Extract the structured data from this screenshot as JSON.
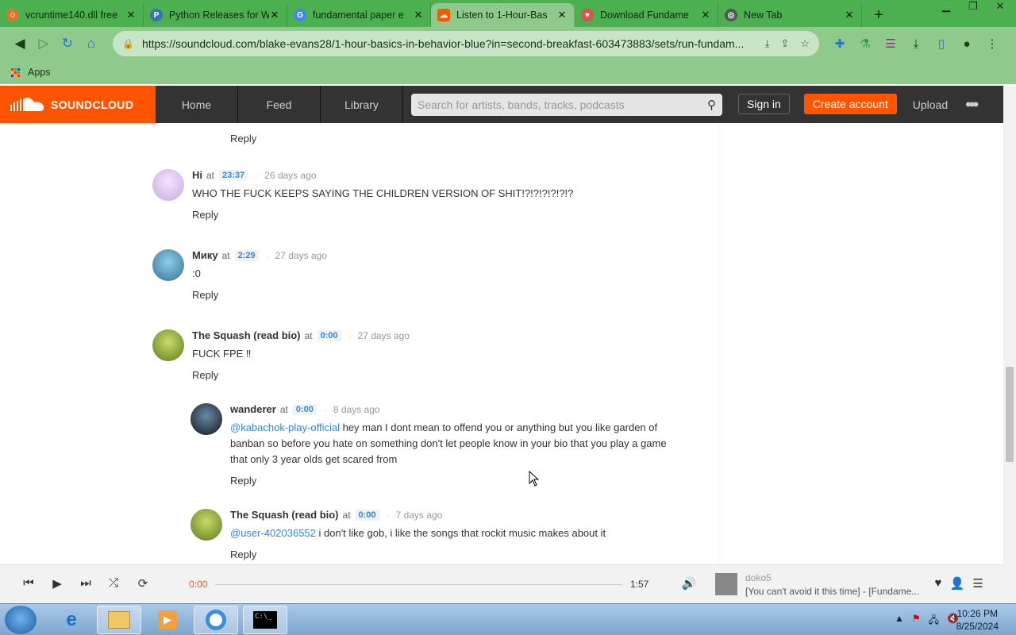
{
  "browser": {
    "tabs": [
      {
        "title": "vcruntime140.dll free",
        "icon_color": "#d9762b",
        "active": false
      },
      {
        "title": "Python Releases for W",
        "icon_color": "#3776ab",
        "active": false
      },
      {
        "title": "fundamental paper e",
        "icon_color": "#4285f4",
        "active": false
      },
      {
        "title": "Listen to 1-Hour-Bas",
        "icon_color": "#ff5500",
        "active": true
      },
      {
        "title": "Download Fundame",
        "icon_color": "#d9534f",
        "active": false
      },
      {
        "title": "New Tab",
        "icon_color": "#555555",
        "active": false
      }
    ],
    "url": "https://soundcloud.com/blake-evans28/1-hour-basics-in-behavior-blue?in=second-breakfast-603473883/sets/run-fundam...",
    "bookmarks_apps": "Apps"
  },
  "soundcloud": {
    "logo_text": "SOUNDCLOUD",
    "nav": [
      "Home",
      "Feed",
      "Library"
    ],
    "search_placeholder": "Search for artists, bands, tracks, podcasts",
    "sign_in": "Sign in",
    "create_account": "Create account",
    "upload": "Upload",
    "more": "•••"
  },
  "comments": {
    "top_reply": "Reply",
    "items": [
      {
        "user": "Hi",
        "at": "at",
        "time": "23:37",
        "ago": "26 days ago",
        "text": "WHO THE FUCK KEEPS SAYING THE CHILDREN VERSION OF SHIT!?!?!?!?!?!?",
        "reply": "Reply",
        "avatar_color": "#c9a6e0"
      },
      {
        "user": "Мику",
        "at": "at",
        "time": "2:29",
        "ago": "27 days ago",
        "text": ":0",
        "reply": "Reply",
        "avatar_color": "#3b6f8f"
      },
      {
        "user": "The Squash (read bio)",
        "at": "at",
        "time": "0:00",
        "ago": "27 days ago",
        "text": "FUCK FPE ‼",
        "reply": "Reply",
        "avatar_color": "#7a9a2a"
      },
      {
        "user": "wanderer",
        "at": "at",
        "time": "0:00",
        "ago": "8 days ago",
        "mention": "@kabachok-play-official",
        "text": " hey man I dont mean to offend you or anything but you like garden of banban so before you hate on something don't let people know in your bio that you play a game that only 3 year olds get scared from",
        "reply": "Reply",
        "avatar_color": "#20262e"
      },
      {
        "user": "The Squash (read bio)",
        "at": "at",
        "time": "0:00",
        "ago": "7 days ago",
        "mention": "@user-402036552",
        "text": " i don't like gob, i like the songs that rockit music makes about it",
        "reply": "Reply",
        "avatar_color": "#7a9a2a"
      }
    ]
  },
  "player": {
    "current_time": "0:00",
    "duration": "1:57",
    "progress_percent": 0,
    "artist": "doko5",
    "title": "[You can't avoid it this time] - [Fundame..."
  },
  "taskbar": {
    "time": "10:26 PM",
    "date": "8/25/2024"
  },
  "colors": {
    "accent": "#ff5500",
    "link": "#3388dd",
    "browser_frame": "#4caf50"
  }
}
